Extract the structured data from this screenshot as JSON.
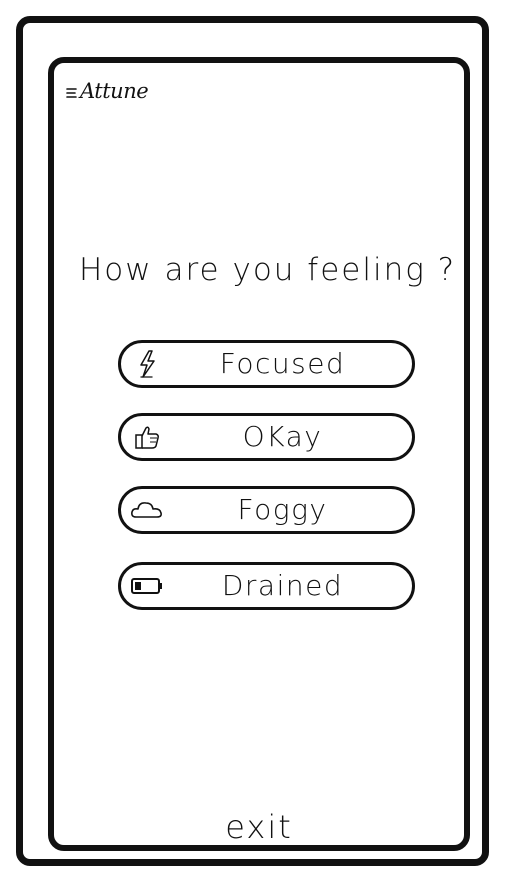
{
  "app": {
    "title": "Attune",
    "menu_icon": "hamburger-icon"
  },
  "prompt": {
    "question": "How are you feeling ?"
  },
  "options": [
    {
      "label": "Focused",
      "icon": "lightning-bolt-icon"
    },
    {
      "label": "OKay",
      "icon": "thumbs-up-icon"
    },
    {
      "label": "Foggy",
      "icon": "cloud-icon"
    },
    {
      "label": "Drained",
      "icon": "low-battery-icon"
    }
  ],
  "footer": {
    "exit_label": "exit"
  },
  "colors": {
    "ink": "#111111",
    "background": "#ffffff"
  }
}
